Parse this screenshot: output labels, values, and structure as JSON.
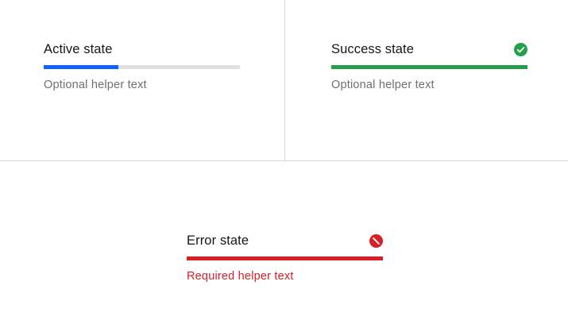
{
  "colors": {
    "active": "#0f62fe",
    "success": "#24a148",
    "error": "#da1e28",
    "track": "#e0e0e0",
    "divider": "#d6d6d6",
    "helper_text": "#6f6f6f",
    "label_text": "#161616"
  },
  "progress_bars": {
    "active": {
      "label": "Active state",
      "helper": "Optional helper text",
      "value_percent": 38,
      "status": "active"
    },
    "success": {
      "label": "Success state",
      "helper": "Optional helper text",
      "value_percent": 100,
      "status": "finished",
      "icon": "checkmark-filled-icon"
    },
    "error": {
      "label": "Error state",
      "helper": "Required helper text",
      "value_percent": 100,
      "status": "error",
      "icon": "error-filled-icon"
    }
  }
}
